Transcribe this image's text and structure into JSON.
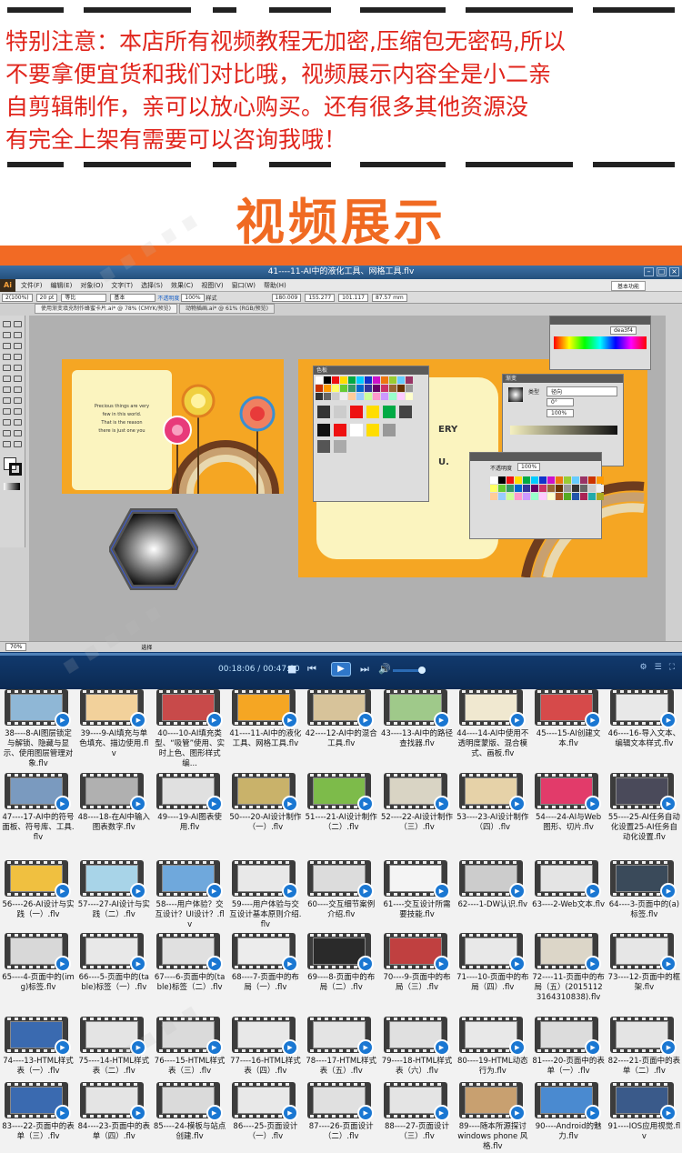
{
  "notice": {
    "lines": [
      "特别注意：本店所有视频教程无加密,压缩包无密码,所以",
      "不要拿便宜货和我们对比哦，视频展示内容全是小二亲",
      "自剪辑制作，亲可以放心购买。还有很多其他资源没",
      "有完全上架有需要可以咨询我哦！"
    ]
  },
  "heading": "视频展示",
  "player": {
    "window_title": "41----11-AI中的液化工具、网格工具.flv",
    "time_current": "00:18:06",
    "time_total": "00:47:00",
    "app": {
      "logo": "Ai",
      "menus": [
        "文件(F)",
        "编辑(E)",
        "对象(O)",
        "文字(T)",
        "选择(S)",
        "效果(C)",
        "视图(V)",
        "窗口(W)",
        "帮助(H)"
      ],
      "workspace": "基本功能",
      "ctrl_left": "2(100%)",
      "stroke_value": "20 pt",
      "ctrl_labels": [
        "等比",
        "基本",
        "不透明度",
        "100%",
        "样式"
      ],
      "coords": [
        "180.009",
        "155.277",
        "101.117",
        "87.57 mm"
      ],
      "tabs": [
        "使用渐变填充制作蜂蜜卡片.ai* @ 78% (CMYK/预览)",
        "动物插画.ai* @ 61% (RGB/预览)"
      ],
      "status_zoom": "70%",
      "status_tool": "选择",
      "card_text": [
        "Precious things are very",
        "few in this world.",
        "That is the reason",
        "there is just one you"
      ],
      "panel_swatches": "色板",
      "panel_gradient": "渐变",
      "gradient_type_label": "类型",
      "gradient_type": "径向",
      "gradient_angle": "0°",
      "gradient_pct": "100%",
      "opacity_label": "不透明度",
      "opacity_value": "100%",
      "color_panel_hex": "dea3f4",
      "card2_text": [
        "ERY",
        "U."
      ]
    }
  },
  "thumbnails": [
    {
      "label": "38----8-AI图层锁定与解锁、隐藏与显示、使用图层管理对象.flv",
      "shot": "#8fb7d6"
    },
    {
      "label": "39----9-AI填充与单色填充、描边使用.flv",
      "shot": "#f2d19b"
    },
    {
      "label": "40----10-AI填充类型、“吸管”使用、实时上色、图形样式编...",
      "shot": "#c84a4a"
    },
    {
      "label": "41----11-AI中的液化工具、网格工具.flv",
      "shot": "#f5a623"
    },
    {
      "label": "42----12-AI中的混合工具.flv",
      "shot": "#d7c39a"
    },
    {
      "label": "43----13-AI中的路径查找器.flv",
      "shot": "#9fc98a"
    },
    {
      "label": "44----14-AI中使用不透明度蒙版、混合模式、画板.flv",
      "shot": "#f0e8d0"
    },
    {
      "label": "45----15-AI创建文本.flv",
      "shot": "#d64a4a"
    },
    {
      "label": "46----16-导入文本、编辑文本样式.flv",
      "shot": "#e8e8e8"
    },
    {
      "label": "47----17-AI中的符号面板、符号库、工具.flv",
      "shot": "#7a9abf"
    },
    {
      "label": "48----18-在AI中输入图表数字.flv",
      "shot": "#b0b0b0"
    },
    {
      "label": "49----19-AI图表使用.flv",
      "shot": "#e0e0e0"
    },
    {
      "label": "50----20-AI设计制作（一）.flv",
      "shot": "#c9b26a"
    },
    {
      "label": "51----21-AI设计制作（二）.flv",
      "shot": "#7dbb4a"
    },
    {
      "label": "52----22-AI设计制作（三）.flv",
      "shot": "#d9d4c4"
    },
    {
      "label": "53----23-AI设计制作（四）.flv",
      "shot": "#e6d2a8"
    },
    {
      "label": "54----24-AI与Web图形、切片.flv",
      "shot": "#e23b6a"
    },
    {
      "label": "55----25-AI任务自动化设置25-AI任务自动化设置.flv",
      "shot": "#4a4a5a"
    },
    {
      "label": "56----26-AI设计与实践（一）.flv",
      "shot": "#f0c040"
    },
    {
      "label": "57----27-AI设计与实践（二）.flv",
      "shot": "#a8d4e8"
    },
    {
      "label": "58----用户体验？交互设计？UI设计？.flv",
      "shot": "#6fa8dc"
    },
    {
      "label": "59----用户体验与交互设计基本原则介绍.flv",
      "shot": "#e8e8e8"
    },
    {
      "label": "60----交互细节案例介绍.flv",
      "shot": "#dcdcdc"
    },
    {
      "label": "61----交互设计所需要技能.flv",
      "shot": "#f4f4f4"
    },
    {
      "label": "62----1-DW认识.flv",
      "shot": "#cccccc"
    },
    {
      "label": "63----2-Web文本.flv",
      "shot": "#e4e4e4"
    },
    {
      "label": "64----3-页面中的(a)标签.flv",
      "shot": "#3a4a5a"
    },
    {
      "label": "65----4-页面中的(img)标签.flv",
      "shot": "#d8d8d8"
    },
    {
      "label": "66----5-页面中的(table)标签（一）.flv",
      "shot": "#e8e8e8"
    },
    {
      "label": "67----6-页面中的(table)标签（二）.flv",
      "shot": "#e0e0e0"
    },
    {
      "label": "68----7-页面中的布局（一）.flv",
      "shot": "#ececec"
    },
    {
      "label": "69----8-页面中的布局（二）.flv",
      "shot": "#2a2a2a"
    },
    {
      "label": "70----9-页面中的布局（三）.flv",
      "shot": "#c04040"
    },
    {
      "label": "71----10-页面中的布局（四）.flv",
      "shot": "#e8e8e8"
    },
    {
      "label": "72----11-页面中的布局（五）(20151123164310838).flv",
      "shot": "#dcd6c8"
    },
    {
      "label": "73----12-页面中的框架.flv",
      "shot": "#e6e6e6"
    },
    {
      "label": "74----13-HTML样式表（一）.flv",
      "shot": "#3a6ab0"
    },
    {
      "label": "75----14-HTML样式表（二）.flv",
      "shot": "#e4e4e4"
    },
    {
      "label": "76----15-HTML样式表（三）.flv",
      "shot": "#dadada"
    },
    {
      "label": "77----16-HTML样式表（四）.flv",
      "shot": "#e8e8e8"
    },
    {
      "label": "78----17-HTML样式表（五）.flv",
      "shot": "#e4e4e4"
    },
    {
      "label": "79----18-HTML样式表（六）.flv",
      "shot": "#e0e0e0"
    },
    {
      "label": "80----19-HTML动态行为.flv",
      "shot": "#e8e8e8"
    },
    {
      "label": "81----20-页面中的表单（一）.flv",
      "shot": "#dcdcdc"
    },
    {
      "label": "82----21-页面中的表单（二）.flv",
      "shot": "#e4e4e4"
    },
    {
      "label": "83----22-页面中的表单（三）.flv",
      "shot": "#3a6ab0"
    },
    {
      "label": "84----23-页面中的表单（四）.flv",
      "shot": "#e4e4e4"
    },
    {
      "label": "85----24-模板与站点创建.flv",
      "shot": "#dadada"
    },
    {
      "label": "86----25-页面设计（一）.flv",
      "shot": "#e8e8e8"
    },
    {
      "label": "87----26-页面设计（二）.flv",
      "shot": "#e0e0e0"
    },
    {
      "label": "88----27-页面设计（三）.flv",
      "shot": "#e4e4e4"
    },
    {
      "label": "89----随本所源探讨windows phone 风格.flv",
      "shot": "#c8a070"
    },
    {
      "label": "90----Android的魅力.flv",
      "shot": "#4a8ad0"
    },
    {
      "label": "91----IOS应用视觉.flv",
      "shot": "#3a5a8a"
    }
  ],
  "colors": {
    "notice_red": "#e0241b",
    "heading_orange": "#f06a22",
    "bar_orange": "#f26a24",
    "player_blue": "#0b2a53"
  }
}
